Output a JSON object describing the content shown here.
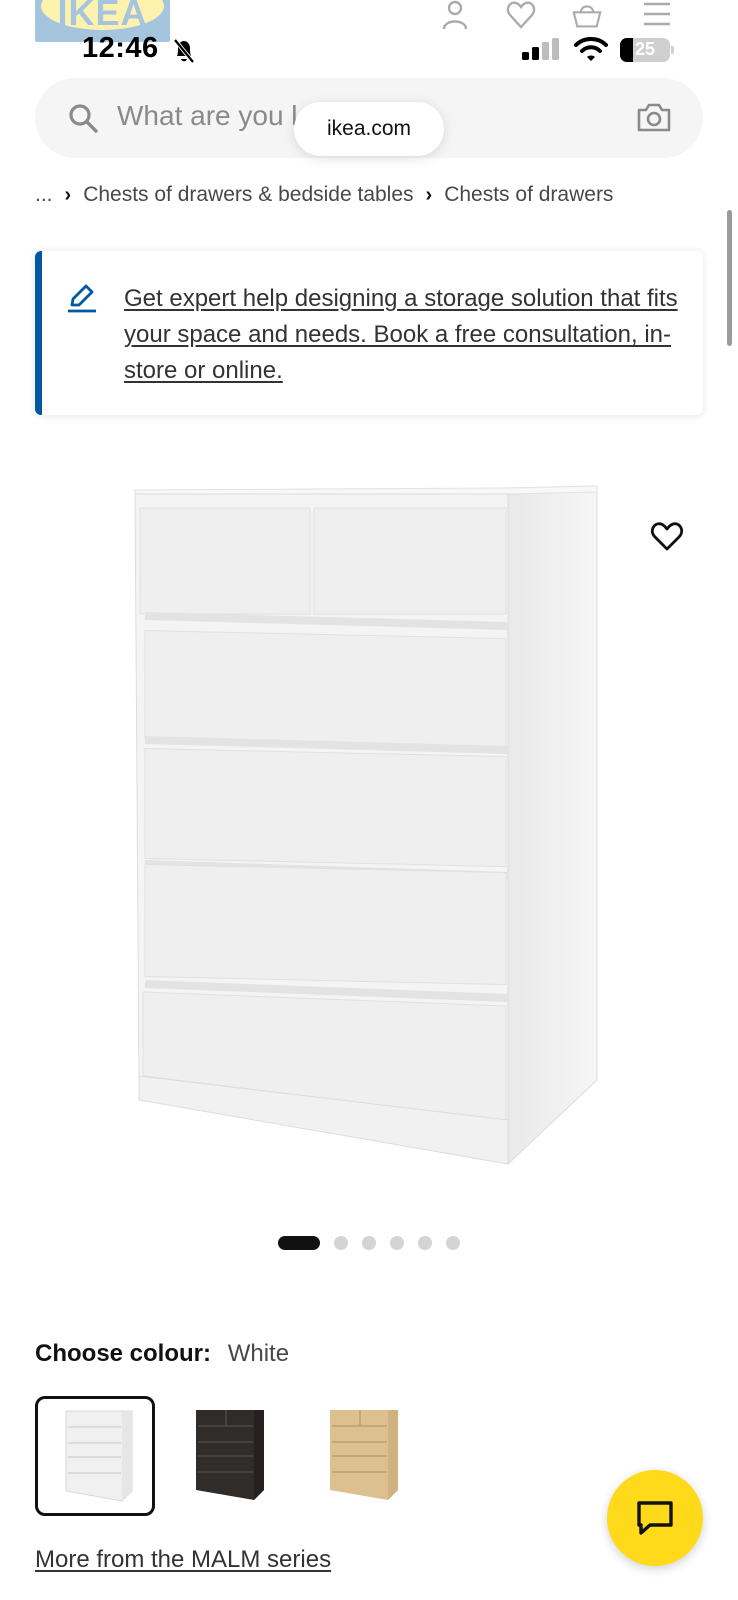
{
  "status_bar": {
    "time": "12:46",
    "battery": "25",
    "battery_level": 0.25
  },
  "header": {
    "logo": "IKEA"
  },
  "search": {
    "placeholder": "What are you looking for?",
    "visible_placeholder": "What are you l",
    "url": "ikea.com"
  },
  "breadcrumb": {
    "ellipsis": "...",
    "items": [
      "Chests of drawers & bedside tables",
      "Chests of drawers"
    ]
  },
  "banner": {
    "text": "Get expert help designing a storage solution that fits your space and needs. Book a free consultation, in-store or online."
  },
  "gallery": {
    "image_count": 6,
    "active_index": 0
  },
  "colour": {
    "label": "Choose colour:",
    "selected": "White",
    "swatches": [
      {
        "name": "White",
        "color": "#f2f2f2"
      },
      {
        "name": "Black-brown",
        "color": "#2f2c2a"
      },
      {
        "name": "White stained oak veneer",
        "color": "#d9bc8c"
      }
    ]
  },
  "series_link": "More from the MALM series",
  "colors": {
    "ikea_blue": "#0058a3",
    "ikea_yellow": "#ffda1a"
  }
}
